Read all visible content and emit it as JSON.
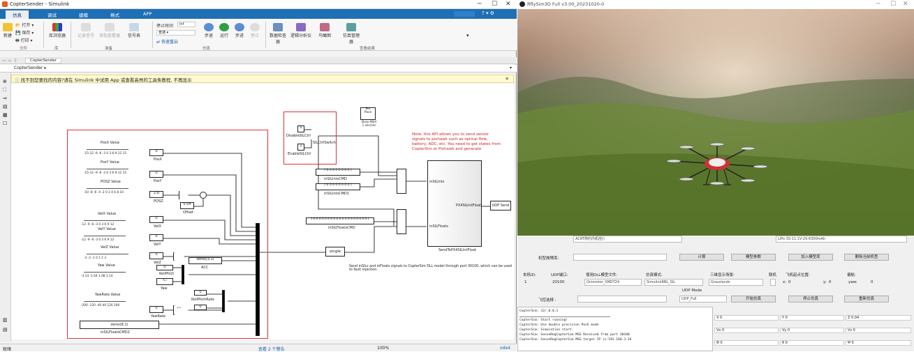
{
  "simulink": {
    "window_title": "CopterSender - Simulink",
    "tabs": [
      "仿真",
      "调试",
      "建模",
      "格式",
      "APP"
    ],
    "ribbon": {
      "file": {
        "open": "打开",
        "save": "保存",
        "print": "打印",
        "new": "新建",
        "section": "文件"
      },
      "library": {
        "browser": "库浏览器",
        "section": "库"
      },
      "prepare": {
        "log_signal": "记录信号",
        "add_viewer": "添加查看器",
        "signal_table": "信号表",
        "section": "准备"
      },
      "simulate": {
        "stop_time_label": "停止时间",
        "stop_time": "inf",
        "mode": "普通",
        "fast_restart": "快速重启",
        "step_back": "步退",
        "run": "运行",
        "step_fwd": "步进",
        "stop": "停止",
        "section": "仿真"
      },
      "review": {
        "data_inspector": "数据检查器",
        "logic_analyzer": "逻辑分析仪",
        "bird_view": "鸟瞰图",
        "sim_manager": "仿真管理器",
        "section": "查看结果"
      }
    },
    "crumb": "CopterSender",
    "path": "CopterSender ▸",
    "info_bar": "找不到您要找的内容?请在 Simulink 中试用 App 或查看高亮的工具条教程, 不再显示",
    "diagram": {
      "sliders": [
        {
          "label": "PosX Value",
          "ticks": "-15-12 -9 -6 -3 0 3 6 9 12 15"
        },
        {
          "label": "PosY Value",
          "ticks": "-15-12 -9 -6 -3 0 3 6 9 12 15"
        },
        {
          "label": "POSZ Value",
          "ticks": "-10 -8 -6 -4 -2 0 2 4 6 8 10"
        },
        {
          "label": "VelX Value",
          "ticks": "-12 -9 -6 -3 0 3 6 9 12"
        },
        {
          "label": "VelY Value",
          "ticks": "-12 -9 -6 -3 0 3 6 9 12"
        },
        {
          "label": "VelZ Value",
          "ticks": "-3 -2 -1 0 1 2 3"
        },
        {
          "label": "Yaw Value",
          "ticks": "-3.14 -1.64 1.08 3.14"
        },
        {
          "label": "YawRate Value",
          "ticks": "-200 -120 -40 40 120 200"
        }
      ],
      "consts": [
        {
          "value": "0",
          "name": "PosX"
        },
        {
          "value": "0",
          "name": "PosY"
        },
        {
          "value": "2.8",
          "name": "POSZ"
        },
        {
          "value": "0",
          "name": "VelX"
        },
        {
          "value": "0",
          "name": "VelY"
        },
        {
          "value": "0",
          "name": "VelZ"
        },
        {
          "value": "0",
          "name": ""
        },
        {
          "value": "0",
          "name": "YawRate"
        }
      ],
      "offset_value": "0.04",
      "offset_name": "Offset",
      "yaw_gain": "-C-",
      "yaw_name": "Yaw",
      "roll_pitch": "RollPitch",
      "roll_pitch_rate": "RollPitchRate",
      "yawrate_gain": "1/200",
      "acc_block": "zeros(3,1)",
      "acc_name": "ACC",
      "floats_cmd2_block": "zeros(8,1)",
      "floats_cmd2_name": "inSILFloatsCMD2",
      "disable_ctrl": {
        "value": "0",
        "name": "DisableSILCtrl"
      },
      "enable_ctrl": {
        "value": "1",
        "name": "EnableSILCtrl"
      },
      "switch_name": "SILCtrlSwitch",
      "set_pace": {
        "title": "Set\nPace",
        "sub": "Busy-Wait\n1 sec/sec"
      },
      "ints_cmd": {
        "value": "[ 0 0 0 0 0 0 0 0 ]",
        "name": "inSILIntsCMD"
      },
      "ints_cmd1": {
        "value": "[ 0 0 0 0 0 0 0 0 ]",
        "name": "inSILIntsCMD1"
      },
      "floats_cmd": {
        "value": "[ 0 0 0 0 0 0 0 0 0 0 0 0 0 0 0 0 0 0 0 ]",
        "name": "inSILFloatsCMD"
      },
      "single_block": "single",
      "subsystem_name": "SendToPX4SILIntFloat",
      "subsystem_ports": {
        "in1": "inSILInts",
        "in2": "inSILFloats",
        "out": "PX4SILIntFloat"
      },
      "udp_send": "UDP Send",
      "note": "Note: this API allows you to send sensor signals to pixhawk such as optical flow, battery, ADC, etc. You need to get states from CopterSim or Pixhawk and generate",
      "footer_note": "Send inSILs and inFloats signals to CopterSim DLL model through port 30100, which can be used to fault injection."
    },
    "status": {
      "left": "就绪",
      "middle": "查看 2 个警告",
      "zoom": "100%",
      "solver": "ode4"
    }
  },
  "mysim": {
    "window_title": "RflySim3D Full v3.00_20231020-0",
    "top_combo_1": "ACRT简约内机控()",
    "top_combo_2": "LiPo 3S-11.1V-2S-6300mAh",
    "fault_label": "机型故障库:",
    "btn_compute": "计算",
    "btn_model_param": "模型参数",
    "btn_add_fault": "加入模型库",
    "btn_delete_model": "删除当前机型",
    "header": {
      "id": "本机ID:",
      "udp": "UDP端口:",
      "dll": "使用DLL模型文件:",
      "sim_mode": "仿真模式:",
      "scene": "三维显示场景:",
      "network": "联机",
      "takeoff": "飞机起点位置:",
      "yaw": "偏航:"
    },
    "row": {
      "id": "1",
      "udp": "20100",
      "dll": "Octorotor_SMDT24",
      "sim_mode": "SimulinkRBL_SIL",
      "scene": "Grasslands",
      "x_label": "x:",
      "x": "0",
      "y_label": "y:",
      "y": "0",
      "yaw_label": "yaw:",
      "yaw": "0"
    },
    "udp_mode_label": "UDP Mode",
    "udp_mode": "UDP_Full",
    "ctrl_label": "飞控选择 :",
    "btn_start": "开始仿真",
    "btn_stop": "停止仿真",
    "btn_reset": "重新仿真",
    "version": "CopterSim: 32/.0.0.1",
    "log": [
      "CopterSim: Start running!",
      "CopterSim: Use double precision PosE mode",
      "CopterSim: Simulation start.",
      "CopterSim: SenseRegCopterSim MSG Received from port 30100",
      "CopterSim: SenseRegCopterSim MSG target IP is:192.168.3.26"
    ],
    "states": [
      {
        "label": "X",
        "value": "0"
      },
      {
        "label": "Y",
        "value": "0"
      },
      {
        "label": "Z",
        "value": "0.04"
      },
      {
        "label": "Vx",
        "value": "0"
      },
      {
        "label": "Vy",
        "value": "0"
      },
      {
        "label": "Vz",
        "value": "0"
      },
      {
        "label": "Φ",
        "value": "0"
      },
      {
        "label": "θ",
        "value": "0"
      },
      {
        "label": "Ψ",
        "value": "0"
      }
    ]
  }
}
